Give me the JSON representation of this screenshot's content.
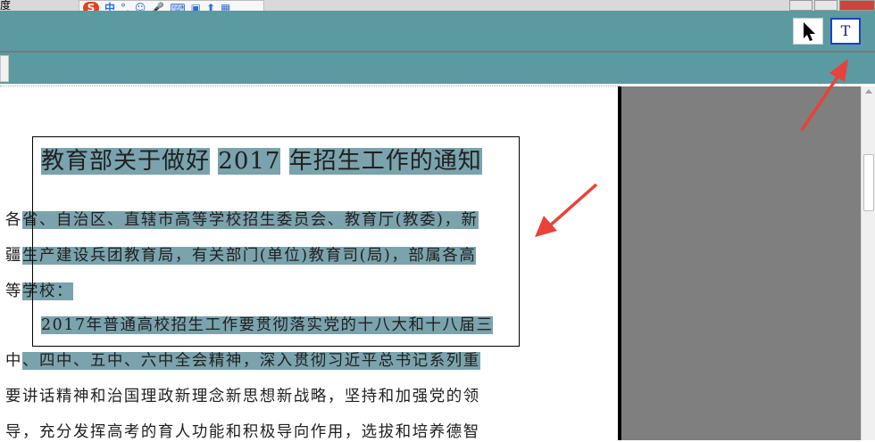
{
  "window": {
    "title_fragment": "度"
  },
  "ime_bar": {
    "logo": "S",
    "mode": "中",
    "punct": "°,"
  },
  "toolbar": {
    "text_tool_label": "T"
  },
  "document": {
    "title": [
      "教育部关于做好",
      "2017",
      "年招生工作的通知"
    ],
    "lines": [
      {
        "plain": "各",
        "highlight": "省、自治区、直辖市高等学校招生委员会、教育厅(教委)，新"
      },
      {
        "plain": "疆",
        "highlight": "生产建设兵团教育局，有关部门(单位)教育司(局)，部属各高"
      },
      {
        "plain": "等",
        "highlight": "学校："
      },
      {
        "plain": "",
        "highlight": "2017年普通高校招生工作要贯彻落实党的十八大和十八届三"
      },
      {
        "plain": "中",
        "highlight": "、四中、五中、六中全会精神，深入贯彻习近平总书记系列重"
      },
      {
        "plain": "要讲话精神和治国理政新理念新思想新战略，坚持和加强党的领",
        "highlight": ""
      },
      {
        "plain": "导，充分发挥高考的育人功能和积极导向作用，选拔和培养德智",
        "highlight": ""
      }
    ]
  },
  "colors": {
    "toolbar": "#5b9aa0",
    "highlight": "#7aa3ad",
    "arrow": "#e8423a",
    "text_tool_border": "#1e3fbf"
  }
}
